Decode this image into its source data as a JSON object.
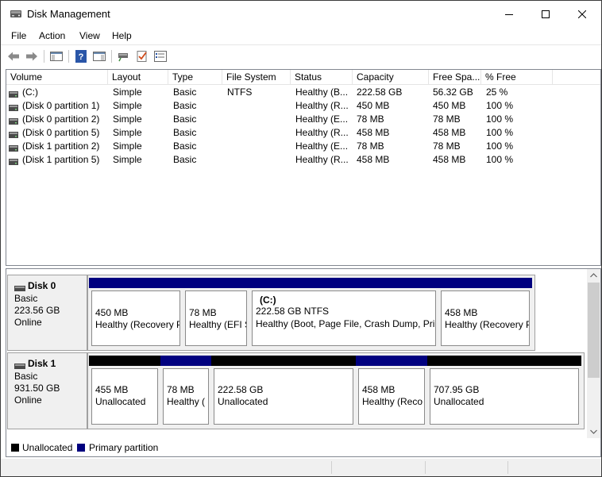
{
  "window": {
    "title": "Disk Management"
  },
  "menu": [
    "File",
    "Action",
    "View",
    "Help"
  ],
  "volume_list": {
    "columns": [
      "Volume",
      "Layout",
      "Type",
      "File System",
      "Status",
      "Capacity",
      "Free Spa...",
      "% Free"
    ],
    "rows": [
      [
        "(C:)",
        "Simple",
        "Basic",
        "NTFS",
        "Healthy (B...",
        "222.58 GB",
        "56.32 GB",
        "25 %"
      ],
      [
        "(Disk 0 partition 1)",
        "Simple",
        "Basic",
        "",
        "Healthy (R...",
        "450 MB",
        "450 MB",
        "100 %"
      ],
      [
        "(Disk 0 partition 2)",
        "Simple",
        "Basic",
        "",
        "Healthy (E...",
        "78 MB",
        "78 MB",
        "100 %"
      ],
      [
        "(Disk 0 partition 5)",
        "Simple",
        "Basic",
        "",
        "Healthy (R...",
        "458 MB",
        "458 MB",
        "100 %"
      ],
      [
        "(Disk 1 partition 2)",
        "Simple",
        "Basic",
        "",
        "Healthy (E...",
        "78 MB",
        "78 MB",
        "100 %"
      ],
      [
        "(Disk 1 partition 5)",
        "Simple",
        "Basic",
        "",
        "Healthy (R...",
        "458 MB",
        "458 MB",
        "100 %"
      ]
    ]
  },
  "disks": [
    {
      "name": "Disk 0",
      "type": "Basic",
      "size": "223.56 GB",
      "state": "Online",
      "partitions": [
        {
          "label": "",
          "size": "450 MB",
          "status": "Healthy (Recovery P",
          "kind": "primary"
        },
        {
          "label": "",
          "size": "78 MB",
          "status": "Healthy (EFI S",
          "kind": "primary"
        },
        {
          "label": "(C:)",
          "size": "222.58 GB NTFS",
          "status": "Healthy (Boot, Page File, Crash Dump, Prir",
          "kind": "primary"
        },
        {
          "label": "",
          "size": "458 MB",
          "status": "Healthy (Recovery P",
          "kind": "primary"
        }
      ]
    },
    {
      "name": "Disk 1",
      "type": "Basic",
      "size": "931.50 GB",
      "state": "Online",
      "partitions": [
        {
          "label": "",
          "size": "455 MB",
          "status": "Unallocated",
          "kind": "unallocated"
        },
        {
          "label": "",
          "size": "78 MB",
          "status": "Healthy (",
          "kind": "primary"
        },
        {
          "label": "",
          "size": "222.58 GB",
          "status": "Unallocated",
          "kind": "unallocated"
        },
        {
          "label": "",
          "size": "458 MB",
          "status": "Healthy (Reco",
          "kind": "primary"
        },
        {
          "label": "",
          "size": "707.95 GB",
          "status": "Unallocated",
          "kind": "unallocated"
        }
      ]
    }
  ],
  "legend": [
    {
      "label": "Unallocated",
      "color": "#000000"
    },
    {
      "label": "Primary partition",
      "color": "#00007f"
    }
  ],
  "colors": {
    "primary": "#00007f",
    "unallocated": "#000000"
  }
}
